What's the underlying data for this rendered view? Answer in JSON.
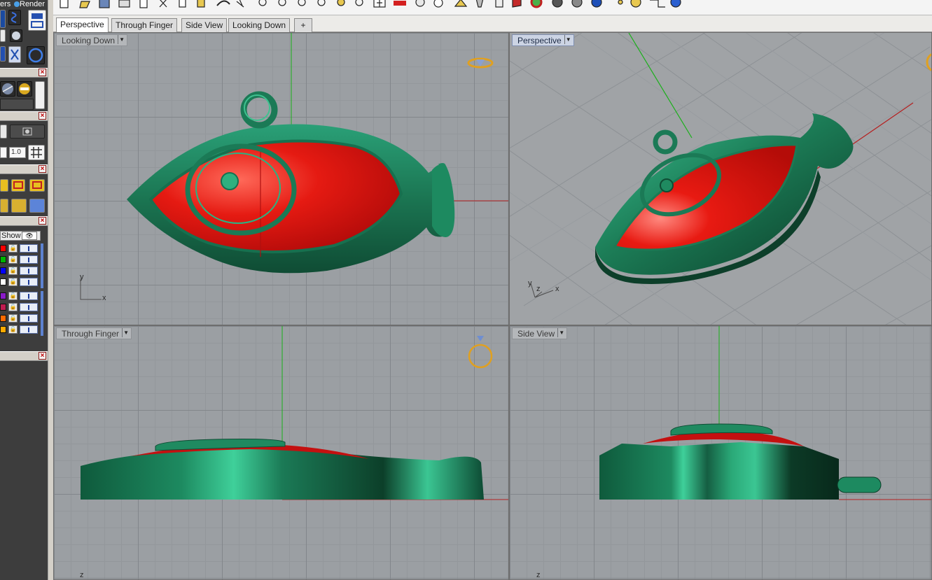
{
  "left_panel": {
    "tabs": [
      {
        "label": "ers",
        "icon": "layers-icon"
      },
      {
        "label": "Render",
        "icon": "render-icon"
      }
    ],
    "grid_value": "1.0",
    "layers_header": "Show",
    "layer_colors": [
      "#ff0000",
      "#00b400",
      "#0000ff",
      "#ffffff",
      "#8a1cc8",
      "#c01c50",
      "#ff6a00",
      "#ffaa00"
    ]
  },
  "toolbar": {
    "icons": [
      "new-icon",
      "open-icon",
      "save-icon",
      "print-icon",
      "copy-icon",
      "cut-icon",
      "clipboard-icon",
      "paste-icon",
      "undo-icon",
      "pan-icon",
      "zoom-window-icon",
      "zoom-icon",
      "zoom-selected-icon",
      "zoom-extents-icon",
      "zoom-dynamic-icon",
      "four-viewports-icon",
      "car-icon",
      "ghosted-icon",
      "rotate-icon",
      "points-icon",
      "light-icon",
      "clipboard2-icon",
      "gem-icon",
      "color-wheel-icon",
      "shade-icon",
      "render-sphere-icon",
      "blue-sphere-icon",
      "gear-icon",
      "dimension-icon",
      "help-icon"
    ]
  },
  "tabs": [
    {
      "label": "Perspective",
      "active": true
    },
    {
      "label": "Through Finger",
      "active": false
    },
    {
      "label": "Side View",
      "active": false
    },
    {
      "label": "Looking Down",
      "active": false
    }
  ],
  "add_tab": "+",
  "viewports": {
    "top_left": {
      "title": "Looking Down",
      "active": false,
      "axis_a": "y",
      "axis_b": "x"
    },
    "top_right": {
      "title": "Perspective",
      "active": true,
      "axis_a": "z",
      "axis_b": "x",
      "axis_c": "y"
    },
    "bottom_left": {
      "title": "Through Finger",
      "active": false,
      "axis_a": "z"
    },
    "bottom_right": {
      "title": "Side View",
      "active": false,
      "axis_a": "z"
    }
  },
  "colors": {
    "model_green": "#1e7e5a",
    "model_red": "#e21510",
    "viewport_bg": "#9b9fa3",
    "x_axis": "#b52020",
    "y_axis": "#19b019"
  }
}
